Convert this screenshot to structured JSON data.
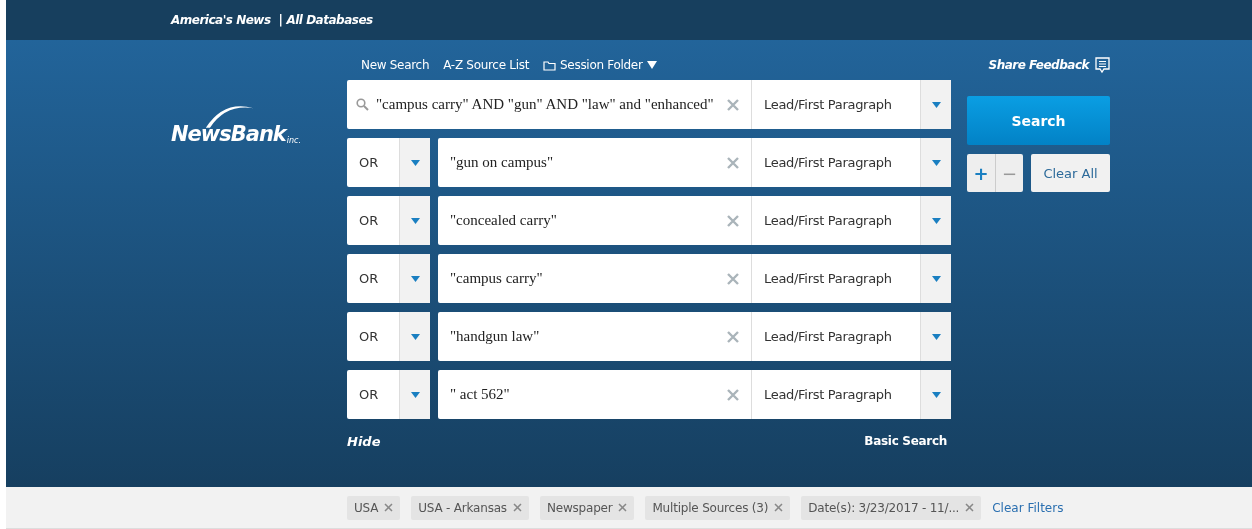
{
  "top_bar": {
    "product": "America's News",
    "separator": "|",
    "database": "All Databases"
  },
  "nav": {
    "links": [
      "New Search",
      "A-Z Source List"
    ],
    "session_folder": "Session Folder",
    "share_feedback": "Share Feedback"
  },
  "logo": {
    "name": "NewsBank",
    "suffix": "inc."
  },
  "search_rows": [
    {
      "operator": null,
      "query": "\"campus carry\" AND \"gun\" AND \"law\" and \"enhanced\"",
      "field": "Lead/First Paragraph"
    },
    {
      "operator": "OR",
      "query": "\"gun on campus\"",
      "field": "Lead/First Paragraph"
    },
    {
      "operator": "OR",
      "query": "\"concealed carry\"",
      "field": "Lead/First Paragraph"
    },
    {
      "operator": "OR",
      "query": "\"campus carry\"",
      "field": "Lead/First Paragraph"
    },
    {
      "operator": "OR",
      "query": "\"handgun law\"",
      "field": "Lead/First Paragraph"
    },
    {
      "operator": "OR",
      "query": "\" act 562\"",
      "field": "Lead/First Paragraph"
    }
  ],
  "buttons": {
    "search": "Search",
    "add": "+",
    "remove": "−",
    "clear_all": "Clear All"
  },
  "footer_links": {
    "hide": "Hide",
    "basic_search": "Basic Search"
  },
  "filters": [
    {
      "label": "USA"
    },
    {
      "label": "USA - Arkansas"
    },
    {
      "label": "Newspaper"
    },
    {
      "label": "Multiple Sources (3)"
    },
    {
      "label": "Date(s): 3/23/2017 - 11/..."
    }
  ],
  "clear_filters": "Clear Filters"
}
